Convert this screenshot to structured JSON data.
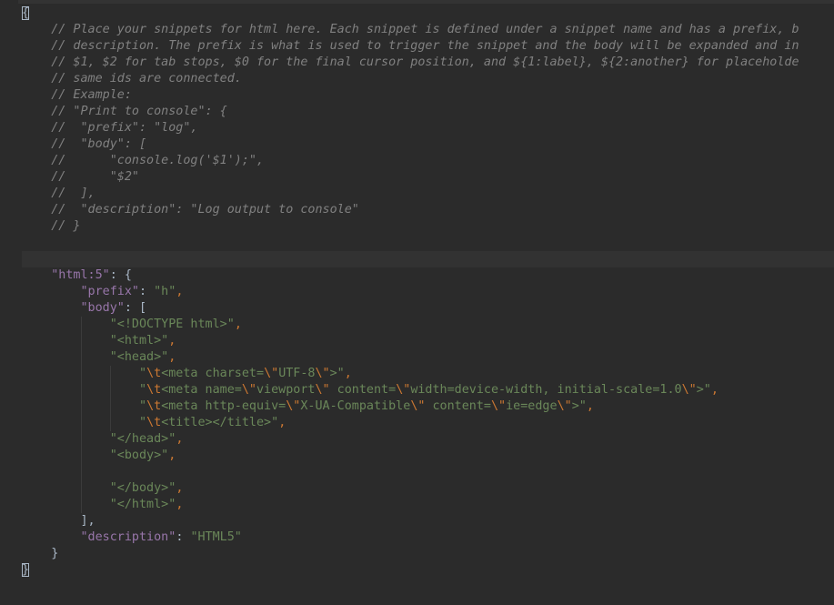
{
  "theme": {
    "background": "#2b2b2b",
    "comment": "#808080",
    "key": "#9876aa",
    "string": "#6a8759",
    "escape": "#cc7832",
    "plain": "#a9b7c6"
  },
  "editor": {
    "current_line": 15,
    "lines": [
      [
        [
          "brace-match",
          "{"
        ]
      ],
      [
        [
          "plain",
          "    "
        ],
        [
          "comment",
          "// Place your snippets for html here. Each snippet is defined under a snippet name and has a prefix, b"
        ]
      ],
      [
        [
          "plain",
          "    "
        ],
        [
          "comment",
          "// description. The prefix is what is used to trigger the snippet and the body will be expanded and in"
        ]
      ],
      [
        [
          "plain",
          "    "
        ],
        [
          "comment",
          "// $1, $2 for tab stops, $0 for the final cursor position, and ${1:label}, ${2:another} for placeholde"
        ]
      ],
      [
        [
          "plain",
          "    "
        ],
        [
          "comment",
          "// same ids are connected."
        ]
      ],
      [
        [
          "plain",
          "    "
        ],
        [
          "comment",
          "// Example:"
        ]
      ],
      [
        [
          "plain",
          "    "
        ],
        [
          "comment",
          "// \"Print to console\": {"
        ]
      ],
      [
        [
          "plain",
          "    "
        ],
        [
          "comment",
          "//  \"prefix\": \"log\","
        ]
      ],
      [
        [
          "plain",
          "    "
        ],
        [
          "comment",
          "//  \"body\": ["
        ]
      ],
      [
        [
          "plain",
          "    "
        ],
        [
          "comment",
          "//      \"console.log('$1');\","
        ]
      ],
      [
        [
          "plain",
          "    "
        ],
        [
          "comment",
          "//      \"$2\""
        ]
      ],
      [
        [
          "plain",
          "    "
        ],
        [
          "comment",
          "//  ],"
        ]
      ],
      [
        [
          "plain",
          "    "
        ],
        [
          "comment",
          "//  \"description\": \"Log output to console\""
        ]
      ],
      [
        [
          "plain",
          "    "
        ],
        [
          "comment",
          "// }"
        ]
      ],
      [],
      [],
      [
        [
          "plain",
          "    "
        ],
        [
          "key",
          "\"html:5\""
        ],
        [
          "plain",
          ": {"
        ]
      ],
      [
        [
          "plain",
          "        "
        ],
        [
          "key",
          "\"prefix\""
        ],
        [
          "plain",
          ": "
        ],
        [
          "string",
          "\"h\""
        ],
        [
          "comma",
          ","
        ]
      ],
      [
        [
          "plain",
          "        "
        ],
        [
          "key",
          "\"body\""
        ],
        [
          "plain",
          ": ["
        ]
      ],
      [
        [
          "plain",
          "            "
        ],
        [
          "string",
          "\"<!DOCTYPE html>\""
        ],
        [
          "comma",
          ","
        ]
      ],
      [
        [
          "plain",
          "            "
        ],
        [
          "string",
          "\"<html>\""
        ],
        [
          "comma",
          ","
        ]
      ],
      [
        [
          "plain",
          "            "
        ],
        [
          "string",
          "\"<head>\""
        ],
        [
          "comma",
          ","
        ]
      ],
      [
        [
          "plain",
          "                "
        ],
        [
          "string",
          "\""
        ],
        [
          "escape",
          "\\t"
        ],
        [
          "string",
          "<meta charset="
        ],
        [
          "escape",
          "\\\""
        ],
        [
          "string",
          "UTF-8"
        ],
        [
          "escape",
          "\\\""
        ],
        [
          "string",
          ">\""
        ],
        [
          "comma",
          ","
        ]
      ],
      [
        [
          "plain",
          "                "
        ],
        [
          "string",
          "\""
        ],
        [
          "escape",
          "\\t"
        ],
        [
          "string",
          "<meta name="
        ],
        [
          "escape",
          "\\\""
        ],
        [
          "string",
          "viewport"
        ],
        [
          "escape",
          "\\\""
        ],
        [
          "string",
          " content="
        ],
        [
          "escape",
          "\\\""
        ],
        [
          "string",
          "width=device-width, initial-scale=1.0"
        ],
        [
          "escape",
          "\\\""
        ],
        [
          "string",
          ">\""
        ],
        [
          "comma",
          ","
        ]
      ],
      [
        [
          "plain",
          "                "
        ],
        [
          "string",
          "\""
        ],
        [
          "escape",
          "\\t"
        ],
        [
          "string",
          "<meta http-equiv="
        ],
        [
          "escape",
          "\\\""
        ],
        [
          "string",
          "X-UA-Compatible"
        ],
        [
          "escape",
          "\\\""
        ],
        [
          "string",
          " content="
        ],
        [
          "escape",
          "\\\""
        ],
        [
          "string",
          "ie=edge"
        ],
        [
          "escape",
          "\\\""
        ],
        [
          "string",
          ">\""
        ],
        [
          "comma",
          ","
        ]
      ],
      [
        [
          "plain",
          "                "
        ],
        [
          "string",
          "\""
        ],
        [
          "escape",
          "\\t"
        ],
        [
          "string",
          "<title></title>\""
        ],
        [
          "comma",
          ","
        ]
      ],
      [
        [
          "plain",
          "            "
        ],
        [
          "string",
          "\"</head>\""
        ],
        [
          "comma",
          ","
        ]
      ],
      [
        [
          "plain",
          "            "
        ],
        [
          "string",
          "\"<body>\""
        ],
        [
          "comma",
          ","
        ]
      ],
      [],
      [
        [
          "plain",
          "            "
        ],
        [
          "string",
          "\"</body>\""
        ],
        [
          "comma",
          ","
        ]
      ],
      [
        [
          "plain",
          "            "
        ],
        [
          "string",
          "\"</html>\""
        ],
        [
          "comma",
          ","
        ]
      ],
      [
        [
          "plain",
          "        ],"
        ]
      ],
      [
        [
          "plain",
          "        "
        ],
        [
          "key",
          "\"description\""
        ],
        [
          "plain",
          ": "
        ],
        [
          "string",
          "\"HTML5\""
        ]
      ],
      [
        [
          "plain",
          "    }"
        ]
      ],
      [
        [
          "brace-match",
          "}"
        ]
      ]
    ]
  }
}
